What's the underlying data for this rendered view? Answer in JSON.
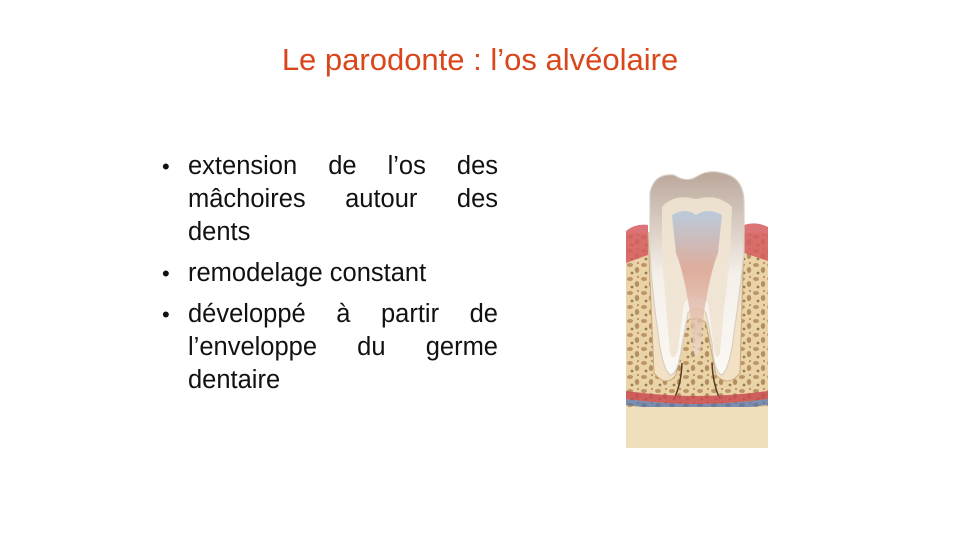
{
  "slide": {
    "title": "Le parodonte : l’os alvéolaire",
    "bullets": [
      {
        "marker": "•",
        "text": " extension de l’os des mâchoires autour des dents"
      },
      {
        "marker": "•",
        "text": " remodelage constant"
      },
      {
        "marker": "•",
        "text": " développé à partir de l’enveloppe du germe dentaire"
      }
    ]
  },
  "colors": {
    "title": "#d9461b",
    "text": "#111111",
    "bone": "#ead3a6",
    "gum": "#d55a5f"
  },
  "illustration": {
    "name": "tooth-in-alveolar-bone-icon"
  }
}
